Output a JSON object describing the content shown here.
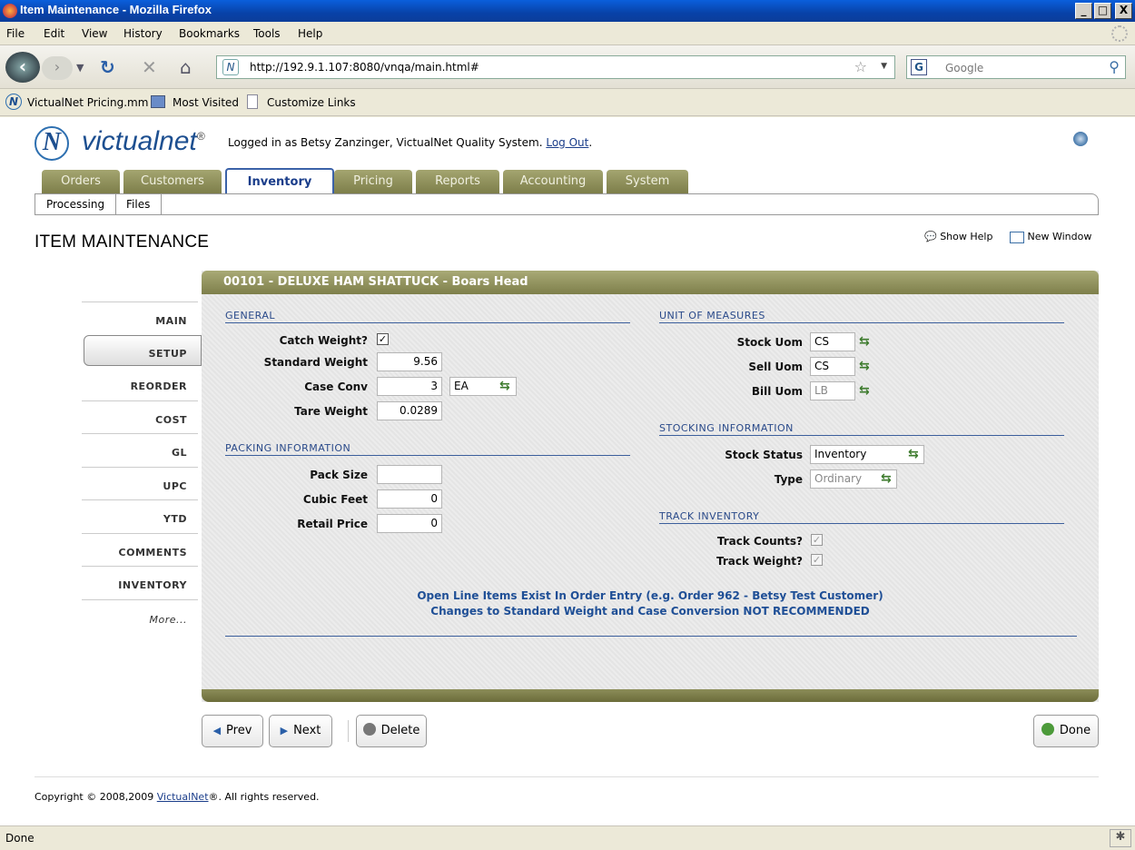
{
  "window": {
    "title": "Item Maintenance - Mozilla Firefox",
    "min": "_",
    "max": "□",
    "close": "X"
  },
  "menu": [
    "File",
    "Edit",
    "View",
    "History",
    "Bookmarks",
    "Tools",
    "Help"
  ],
  "nav": {
    "url": "http://192.9.1.107:8080/vnqa/main.html#",
    "search_placeholder": "Google"
  },
  "bookmarks": [
    "VictualNet Pricing.mm",
    "Most Visited",
    "Customize Links"
  ],
  "header": {
    "brand": "victualnet",
    "brand_mark": "®",
    "logged_in_prefix": "Logged in as Betsy Zanzinger, VictualNet Quality System.",
    "logout": "Log Out",
    "logout_suffix": "."
  },
  "tabs": [
    "Orders",
    "Customers",
    "Inventory",
    "Pricing",
    "Reports",
    "Accounting",
    "System"
  ],
  "active_tab": "Inventory",
  "subnav": [
    "Processing",
    "Files"
  ],
  "page_title": "ITEM MAINTENANCE",
  "actions": {
    "show_help": "Show Help",
    "new_window": "New Window"
  },
  "left_nav": [
    "MAIN",
    "SETUP",
    "REORDER",
    "COST",
    "GL",
    "UPC",
    "YTD",
    "COMMENTS",
    "INVENTORY",
    "More..."
  ],
  "item_header": "00101 - DELUXE HAM SHATTUCK - Boars Head",
  "general": {
    "title": "GENERAL",
    "catch_weight_label": "Catch Weight?",
    "catch_weight_checked": true,
    "standard_weight_label": "Standard Weight",
    "standard_weight": "9.56",
    "case_conv_label": "Case Conv",
    "case_conv": "3",
    "case_conv_uom": "EA",
    "tare_weight_label": "Tare Weight",
    "tare_weight": "0.0289"
  },
  "packing": {
    "title": "PACKING INFORMATION",
    "pack_size_label": "Pack Size",
    "pack_size": "",
    "cubic_feet_label": "Cubic Feet",
    "cubic_feet": "0",
    "retail_price_label": "Retail Price",
    "retail_price": "0"
  },
  "uom": {
    "title": "UNIT OF MEASURES",
    "stock_label": "Stock Uom",
    "stock": "CS",
    "sell_label": "Sell Uom",
    "sell": "CS",
    "bill_label": "Bill Uom",
    "bill": "LB"
  },
  "stocking": {
    "title": "STOCKING INFORMATION",
    "status_label": "Stock Status",
    "status": "Inventory",
    "type_label": "Type",
    "type": "Ordinary"
  },
  "track": {
    "title": "TRACK INVENTORY",
    "counts_label": "Track Counts?",
    "counts_checked": true,
    "weight_label": "Track Weight?",
    "weight_checked": true
  },
  "warning": {
    "line1": "Open Line Items Exist In Order Entry (e.g. Order 962 - Betsy Test Customer)",
    "line2": "Changes to Standard Weight and Case Conversion NOT RECOMMENDED"
  },
  "buttons": {
    "prev": "Prev",
    "next": "Next",
    "delete": "Delete",
    "done": "Done"
  },
  "footer": {
    "copyright_prefix": "Copyright © 2008,2009",
    "copyright_link": "VictualNet",
    "copyright_suffix": "®. All rights reserved."
  },
  "status": "Done"
}
